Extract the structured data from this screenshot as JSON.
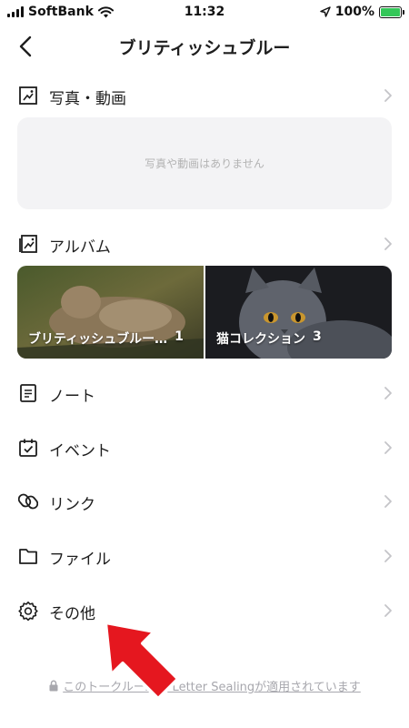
{
  "status_bar": {
    "carrier": "SoftBank",
    "time": "11:32",
    "battery": "100%"
  },
  "header": {
    "title": "ブリティッシュブルー"
  },
  "sections": {
    "photos": {
      "label": "写真・動画",
      "empty_text": "写真や動画はありません"
    },
    "albums": {
      "label": "アルバム",
      "items": [
        {
          "name": "ブリティッシュブルー…",
          "count": "1"
        },
        {
          "name": "猫コレクション",
          "count": "3"
        }
      ]
    },
    "notes": {
      "label": "ノート"
    },
    "events": {
      "label": "イベント"
    },
    "links": {
      "label": "リンク"
    },
    "files": {
      "label": "ファイル"
    },
    "other": {
      "label": "その他"
    }
  },
  "footer": {
    "text": "このトークルームは Letter Sealingが適用されています"
  },
  "colors": {
    "text": "#1e1e1e",
    "chevron": "#c4c4c8",
    "empty_bg": "#f3f3f5",
    "annotation_arrow": "#e5171f",
    "battery": "#34c759"
  }
}
